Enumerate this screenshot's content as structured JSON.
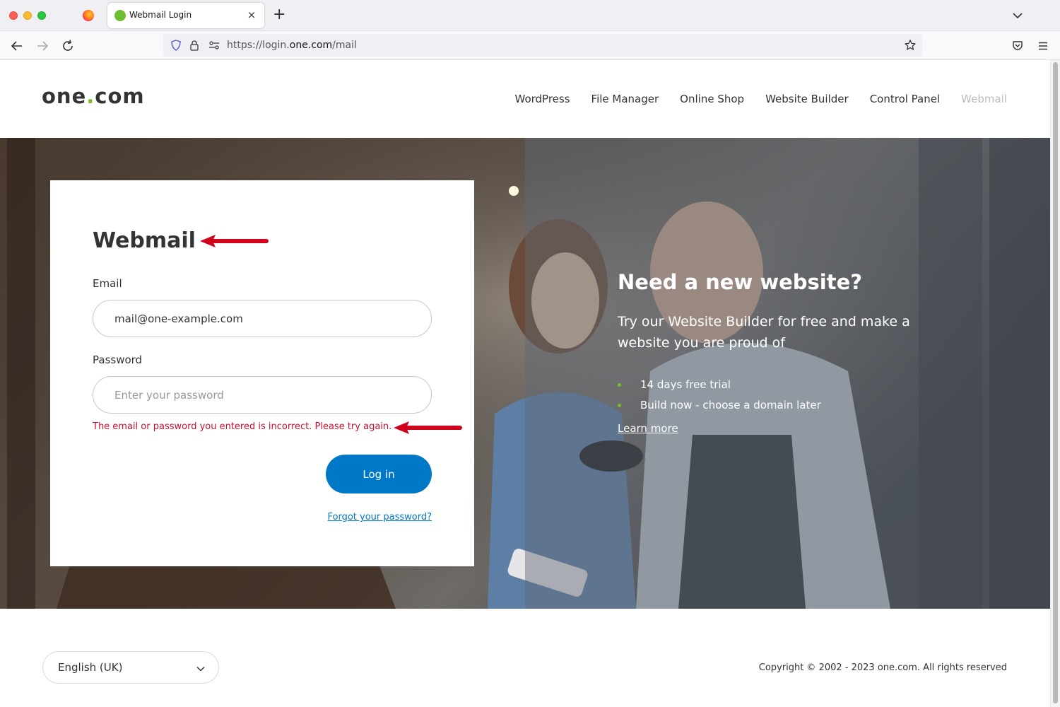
{
  "browser": {
    "tab_title": "Webmail Login",
    "tab_close": "×",
    "new_tab": "+",
    "url_prefix": "https://login.",
    "url_host": "one.com",
    "url_path": "/mail"
  },
  "header": {
    "logo_left": "one",
    "logo_dot": ".",
    "logo_right": "com",
    "nav": [
      "WordPress",
      "File Manager",
      "Online Shop",
      "Website Builder",
      "Control Panel",
      "Webmail"
    ]
  },
  "login": {
    "title": "Webmail",
    "email_label": "Email",
    "email_value": "mail@one-example.com",
    "password_label": "Password",
    "password_placeholder": "Enter your password",
    "error": "The email or password you entered is incorrect. Please try again.",
    "login_button": "Log in",
    "forgot_link": "Forgot your password?"
  },
  "promo": {
    "title": "Need a new website?",
    "subtitle": "Try our Website Builder for free and make a website you are proud of",
    "bullets": [
      "14 days free trial",
      "Build now - choose a domain later"
    ],
    "link": "Learn more"
  },
  "footer": {
    "language": "English (UK)",
    "copyright": "Copyright © 2002 - 2023 one.com. All rights reserved"
  },
  "colors": {
    "brand_green": "#78be20",
    "primary_blue": "#0078c8",
    "error_red": "#c8102e",
    "annotation_red": "#d0021b"
  },
  "icons": [
    "firefox-icon",
    "favicon-icon",
    "back-icon",
    "forward-icon",
    "reload-icon",
    "shield-icon",
    "lock-icon",
    "permissions-icon",
    "star-icon",
    "pocket-icon",
    "menu-icon",
    "chevron-down-icon"
  ]
}
